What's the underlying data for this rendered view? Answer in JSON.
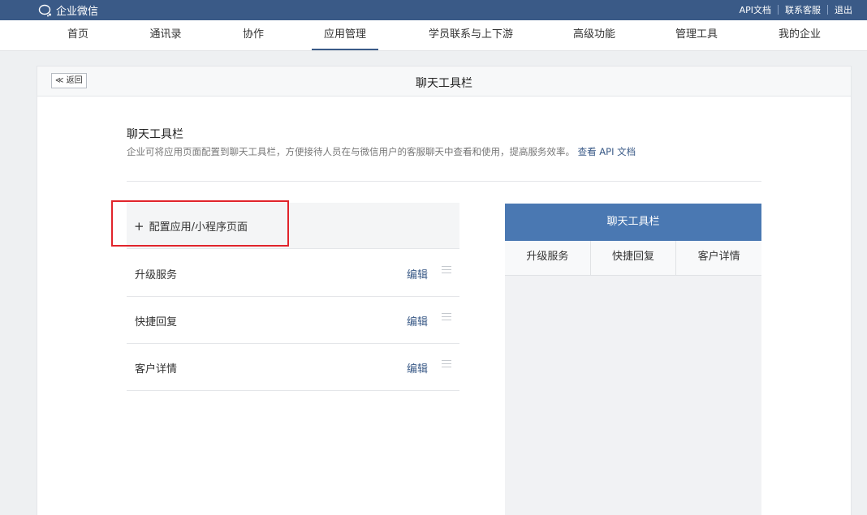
{
  "topbar": {
    "logo_text": "企业微信",
    "links": [
      "API文档",
      "联系客服",
      "退出"
    ]
  },
  "nav": {
    "items": [
      "首页",
      "通讯录",
      "协作",
      "应用管理",
      "学员联系与上下游",
      "高级功能",
      "管理工具",
      "我的企业"
    ],
    "active_index": 3
  },
  "panel": {
    "back_label": "≪ 返回",
    "title": "聊天工具栏"
  },
  "section": {
    "title": "聊天工具栏",
    "description": "企业可将应用页面配置到聊天工具栏，方便接待人员在与微信用户的客服聊天中查看和使用，提高服务效率。",
    "api_link": "查看 API 文档"
  },
  "add": {
    "icon": "plus-icon",
    "label": "配置应用/小程序页面"
  },
  "menu_items": [
    {
      "name": "升级服务",
      "edit": "编辑"
    },
    {
      "name": "快捷回复",
      "edit": "编辑"
    },
    {
      "name": "客户详情",
      "edit": "编辑"
    }
  ],
  "preview": {
    "title": "聊天工具栏",
    "tabs": [
      "升级服务",
      "快捷回复",
      "客户详情"
    ]
  },
  "colors": {
    "topbar": "#3a5a87",
    "accent": "#4a78b2",
    "highlight": "#e1242b"
  }
}
